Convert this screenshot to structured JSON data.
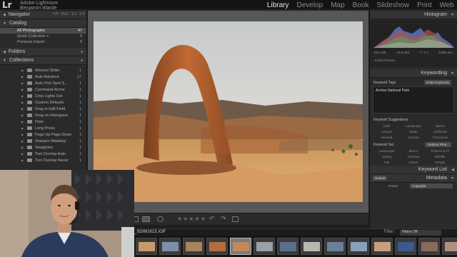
{
  "app": {
    "logo": "Lr",
    "identity_line1": "Adobe Lightroom",
    "identity_line2": "Benjamin Warde"
  },
  "modules": [
    "Library",
    "Develop",
    "Map",
    "Book",
    "Slideshow",
    "Print",
    "Web"
  ],
  "active_module": "Library",
  "left_panel": {
    "navigator": {
      "title": "Navigator",
      "options": [
        "FIT",
        "FILL",
        "1:1",
        "1:4"
      ]
    },
    "catalog": {
      "title": "Catalog",
      "rows": [
        {
          "label": "All Photographs",
          "count": "47"
        },
        {
          "label": "Quick Collection +",
          "count": "0"
        },
        {
          "label": "Previous Import",
          "count": "0"
        }
      ]
    },
    "folders": {
      "title": "Folders"
    },
    "collections": {
      "title": "Collections",
      "items": [
        {
          "label": "Amount Slider",
          "count": "1"
        },
        {
          "label": "Auto Advance",
          "count": "17"
        },
        {
          "label": "Auto Pick Spot S...",
          "count": "1"
        },
        {
          "label": "Command-Arrow",
          "count": "1"
        },
        {
          "label": "Crop Lights Out",
          "count": "1"
        },
        {
          "label": "Custom Defaults",
          "count": "1"
        },
        {
          "label": "Drag in Edit Field",
          "count": "1"
        },
        {
          "label": "Drag on Histogram",
          "count": "1"
        },
        {
          "label": "Flow",
          "count": "1"
        },
        {
          "label": "Long Press",
          "count": "1"
        },
        {
          "label": "Page Up Page Down",
          "count": "1"
        },
        {
          "label": "Sharpen Masking",
          "count": "1"
        },
        {
          "label": "Straighten",
          "count": "1"
        },
        {
          "label": "Tool Overlay Auto",
          "count": "1"
        },
        {
          "label": "Tool Overlay Never",
          "count": "1"
        }
      ]
    }
  },
  "right_panel": {
    "histogram": {
      "title": "Histogram",
      "info": [
        "ISO 100",
        "16.4 mm",
        "f / 7.1",
        "1/250 sec"
      ],
      "smart_preview": "Smart Preview"
    },
    "keywording": {
      "title": "Keywording",
      "tags_label": "Keyword Tags",
      "tags_mode": "Enter Keywords",
      "tags_value": "Arches National Park",
      "suggestions_label": "Keyword Suggestions",
      "suggestions": [
        "Utah",
        "Landscape",
        "Nature",
        "Oregon",
        "Water",
        "California",
        "Nevada",
        "Arizona",
        "Panorama"
      ],
      "set_label": "Keyword Set",
      "set_value": "Outdoor Phot...",
      "set_items": [
        "Landscape",
        "Macro",
        "Flowers & Pl",
        "Spring",
        "Summer",
        "Wildlife",
        "Fall",
        "Winter",
        "People"
      ]
    },
    "keyword_list": {
      "title": "Keyword List"
    },
    "metadata": {
      "title": "Metadata",
      "preset_label": "Preset",
      "preset_value": "Copyright",
      "view_value": "Default"
    }
  },
  "filmstrip": {
    "filename": "_SDIM1615.X3F",
    "filter_label": "Filter :",
    "filter_value": "Filters Off",
    "thumb_count": 14,
    "selected_index": 4
  },
  "toolbar": {
    "stars": "★★★★★"
  },
  "colors": {
    "accent_active": "#e6e6e6",
    "panel_bg": "#2a2a2a",
    "center_bg": "#575757"
  }
}
